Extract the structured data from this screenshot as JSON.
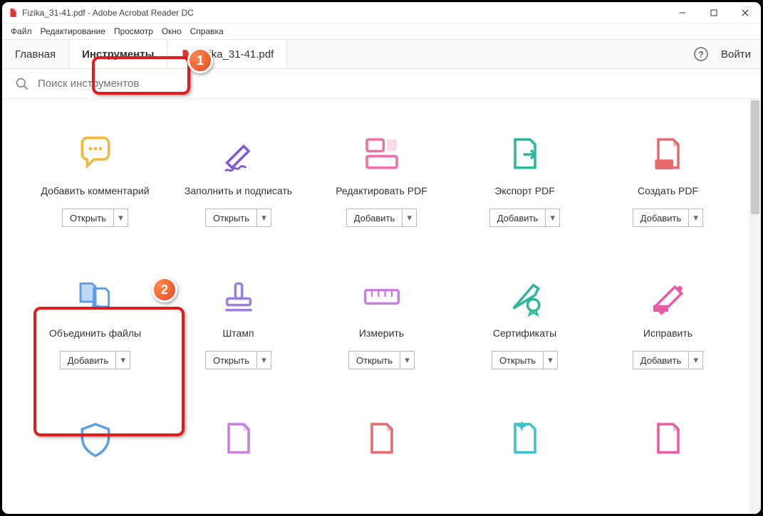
{
  "window": {
    "title": "Fizika_31-41.pdf - Adobe Acrobat Reader DC"
  },
  "menu": {
    "file": "Файл",
    "edit": "Редактирование",
    "view": "Просмотр",
    "window": "Окно",
    "help": "Справка"
  },
  "tabs": {
    "home": "Главная",
    "tools": "Инструменты",
    "doc": "Fizika_31-41.pdf"
  },
  "topbar": {
    "login": "Войти",
    "help_symbol": "?"
  },
  "search": {
    "placeholder": "Поиск инструментов"
  },
  "actions": {
    "open": "Открыть",
    "add": "Добавить"
  },
  "tools": {
    "comment": {
      "label": "Добавить комментарий",
      "action": "open",
      "color": "#f2b63a"
    },
    "fill_sign": {
      "label": "Заполнить и подписать",
      "action": "open",
      "color": "#7f5ad6"
    },
    "edit_pdf": {
      "label": "Редактировать PDF",
      "action": "add",
      "color": "#ed6ea8"
    },
    "export_pdf": {
      "label": "Экспорт PDF",
      "action": "add",
      "color": "#29b89a"
    },
    "create_pdf": {
      "label": "Создать PDF",
      "action": "add",
      "color": "#e46b6b"
    },
    "combine": {
      "label": "Объединить файлы",
      "action": "add",
      "color": "#5d9de8"
    },
    "stamp": {
      "label": "Штамп",
      "action": "open",
      "color": "#9b7ee0"
    },
    "measure": {
      "label": "Измерить",
      "action": "open",
      "color": "#c97fe0"
    },
    "certificates": {
      "label": "Сертификаты",
      "action": "open",
      "color": "#29b89a"
    },
    "redact": {
      "label": "Исправить",
      "action": "add",
      "color": "#e85aa3"
    }
  },
  "markers": {
    "one": "1",
    "two": "2"
  }
}
